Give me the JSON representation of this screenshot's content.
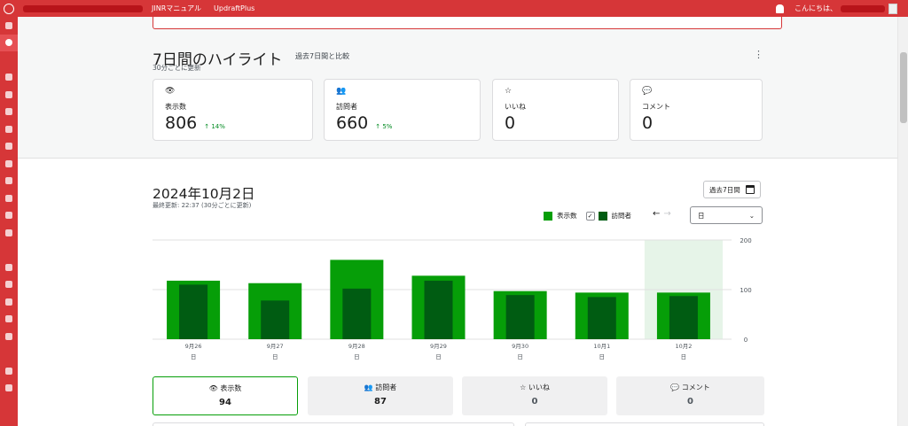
{
  "adminbar": {
    "items": [
      "JINRマニュアル",
      "UpdraftPlus"
    ],
    "greeting": "こんにちは、"
  },
  "highlights": {
    "title": "7日間のハイライト",
    "compare": "過去7日間と比較",
    "subtitle": "30分ごとに更新",
    "more_icon": "⋮",
    "cards": [
      {
        "icon": "👁",
        "label": "表示数",
        "value": "806",
        "change": "↑ 14%"
      },
      {
        "icon": "👥",
        "label": "訪問者",
        "value": "660",
        "change": "↑ 5%"
      },
      {
        "icon": "☆",
        "label": "いいね",
        "value": "0",
        "change": ""
      },
      {
        "icon": "💬",
        "label": "コメント",
        "value": "0",
        "change": ""
      }
    ]
  },
  "stats": {
    "date_title": "2024年10月2日",
    "updated": "最終更新: 22:37 (30分ごとに更新)",
    "period_button": "過去7日間",
    "legend": {
      "views": "表示数",
      "visitors": "訪問者"
    },
    "arrows": {
      "prev": "←",
      "next": "→"
    },
    "unit": "日",
    "colors": {
      "views": "#069e08",
      "visitors": "#005c12",
      "highlight": "#e6f4e8"
    }
  },
  "chart_data": {
    "type": "bar",
    "categories": [
      "9月26",
      "9月27",
      "9月28",
      "9月29",
      "9月30",
      "10月1",
      "10月2"
    ],
    "sublabels": [
      "日",
      "日",
      "日",
      "日",
      "日",
      "日",
      "日"
    ],
    "series": [
      {
        "name": "表示数",
        "values": [
          118,
          113,
          160,
          128,
          97,
          94,
          94
        ]
      },
      {
        "name": "訪問者",
        "values": [
          110,
          78,
          102,
          118,
          89,
          85,
          87
        ]
      }
    ],
    "yticks": [
      0,
      100,
      200
    ],
    "ylim": [
      0,
      200
    ],
    "highlight_index": 6
  },
  "tabs": [
    {
      "icon": "👁",
      "label": "表示数",
      "value": "94",
      "selected": true
    },
    {
      "icon": "👥",
      "label": "訪問者",
      "value": "87",
      "selected": false
    },
    {
      "icon": "☆",
      "label": "いいね",
      "value": "0",
      "selected": false
    },
    {
      "icon": "💬",
      "label": "コメント",
      "value": "0",
      "selected": false
    }
  ]
}
